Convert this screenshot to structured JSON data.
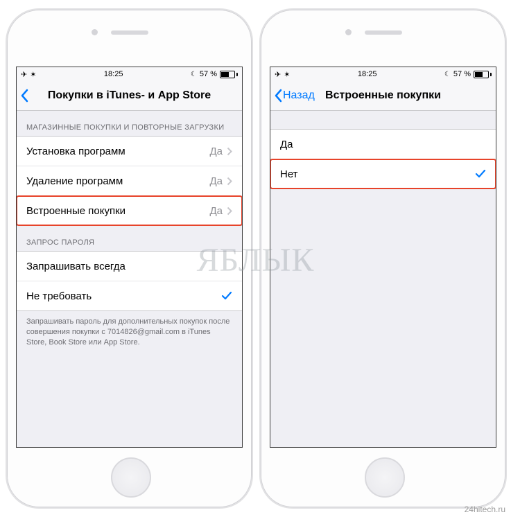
{
  "statusbar": {
    "time": "18:25",
    "batt_pct": "57 %",
    "airplane": "✈",
    "wifi": "✶",
    "moon": "☾"
  },
  "left": {
    "title": "Покупки в iTunes- и App Store",
    "section1": "МАГАЗИННЫЕ ПОКУПКИ И ПОВТОРНЫЕ ЗАГРУЗКИ",
    "rows": [
      {
        "label": "Установка программ",
        "value": "Да"
      },
      {
        "label": "Удаление программ",
        "value": "Да"
      },
      {
        "label": "Встроенные покупки",
        "value": "Да"
      }
    ],
    "section2": "ЗАПРОС ПАРОЛЯ",
    "pw_rows": [
      {
        "label": "Запрашивать всегда"
      },
      {
        "label": "Не требовать"
      }
    ],
    "footer": "Запрашивать пароль для дополнительных покупок после совершения покупки с 7014826@gmail.com в iTunes Store, Book Store или App Store."
  },
  "right": {
    "back": "Назад",
    "title": "Встроенные покупки",
    "options": [
      {
        "label": "Да"
      },
      {
        "label": "Нет"
      }
    ]
  },
  "watermark": "ЯБЛЫК",
  "credit": "24hitech.ru"
}
